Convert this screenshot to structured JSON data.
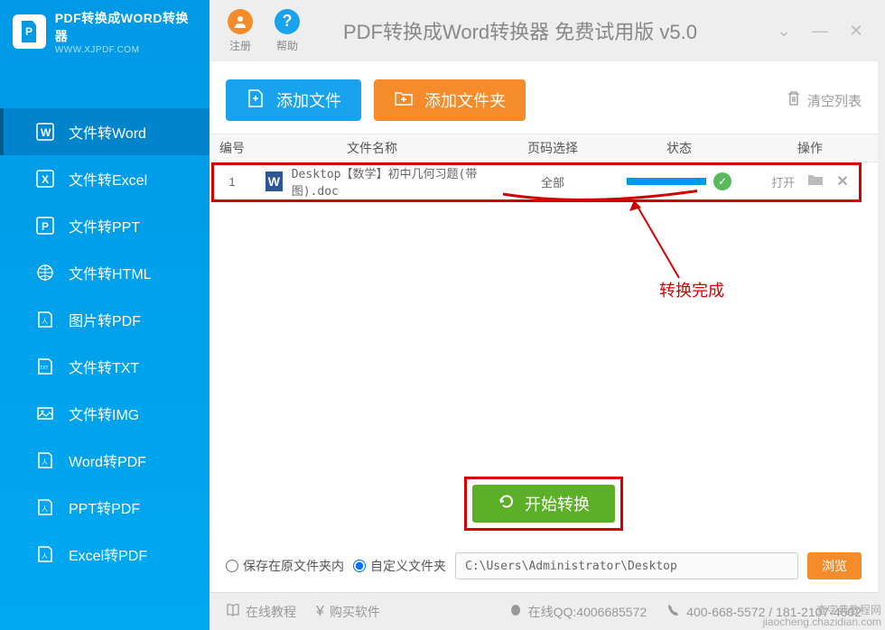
{
  "logo": {
    "title": "PDF转换成WORD转换器",
    "url": "WWW.XJPDF.COM"
  },
  "sidebar": {
    "items": [
      {
        "label": "文件转Word"
      },
      {
        "label": "文件转Excel"
      },
      {
        "label": "文件转PPT"
      },
      {
        "label": "文件转HTML"
      },
      {
        "label": "图片转PDF"
      },
      {
        "label": "文件转TXT"
      },
      {
        "label": "文件转IMG"
      },
      {
        "label": "Word转PDF"
      },
      {
        "label": "PPT转PDF"
      },
      {
        "label": "Excel转PDF"
      }
    ]
  },
  "titlebar": {
    "register_label": "注册",
    "help_label": "帮助",
    "app_title": "PDF转换成Word转换器 免费试用版 v5.0"
  },
  "toolbar": {
    "add_file_label": "添加文件",
    "add_folder_label": "添加文件夹",
    "clear_list_label": "清空列表"
  },
  "table": {
    "headers": {
      "num": "编号",
      "name": "文件名称",
      "page": "页码选择",
      "status": "状态",
      "action": "操作"
    },
    "rows": [
      {
        "num": "1",
        "name": "Desktop【数学】初中几何习题(带图).doc",
        "page": "全部",
        "open": "打开"
      }
    ]
  },
  "annotation": {
    "text": "转换完成"
  },
  "start": {
    "label": "开始转换"
  },
  "save": {
    "option1": "保存在原文件夹内",
    "option2": "自定义文件夹",
    "path": "C:\\Users\\Administrator\\Desktop",
    "browse": "浏览"
  },
  "footer": {
    "tutorial": "在线教程",
    "buy": "购买软件",
    "qq": "在线QQ:4006685572",
    "phone": "400-668-5572 / 181-2107-4602"
  },
  "watermark": {
    "line1": "查字典教程网",
    "line2": "jiaocheng.chazidian.com"
  }
}
